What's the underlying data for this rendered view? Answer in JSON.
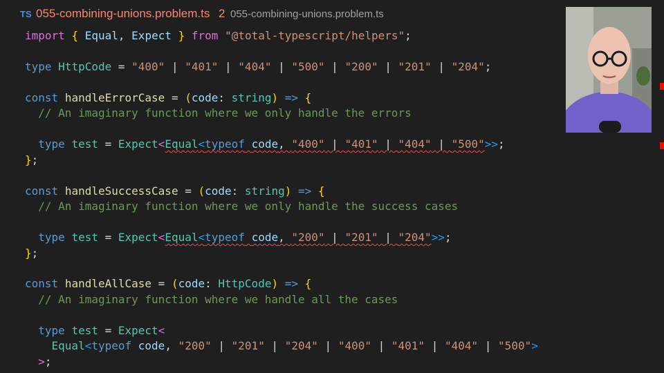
{
  "tab": {
    "lang_badge": "TS",
    "filename": "055-combining-unions.problem.ts",
    "problem_count": "2",
    "description": "055-combining-unions.problem.ts"
  },
  "code": {
    "l1": {
      "kw1": "import",
      "b1": "{",
      "sp1": " ",
      "n1": "Equal",
      "c1": ",",
      "sp2": " ",
      "n2": "Expect",
      "sp3": " ",
      "b2": "}",
      "sp4": " ",
      "kw2": "from",
      "sp5": " ",
      "str": "\"@total-typescript/helpers\"",
      "end": ";"
    },
    "l2": {
      "kw": "type",
      "sp": " ",
      "name": "HttpCode",
      "eq": " = ",
      "v1": "\"400\"",
      "p1": " | ",
      "v2": "\"401\"",
      "p2": " | ",
      "v3": "\"404\"",
      "p3": " | ",
      "v4": "\"500\"",
      "p4": " | ",
      "v5": "\"200\"",
      "p5": " | ",
      "v6": "\"201\"",
      "p6": " | ",
      "v7": "\"204\"",
      "end": ";"
    },
    "l3": {
      "kw": "const",
      "sp": " ",
      "name": "handleErrorCase",
      "eq": " = ",
      "lp": "(",
      "param": "code",
      "colon": ": ",
      "type": "string",
      "rp": ")",
      "arrow": " => ",
      "brace": "{"
    },
    "l4": {
      "comment": "  // An imaginary function where we only handle the errors"
    },
    "l5": {
      "ind": "  ",
      "kw": "type",
      "sp": " ",
      "name": "test",
      "eq": " = ",
      "expect": "Expect",
      "lt1": "<",
      "equal": "Equal",
      "lt2": "<",
      "typeof": "typeof",
      "sp2": " ",
      "code": "code",
      "comma": ", ",
      "v1": "\"400\"",
      "p1": " | ",
      "v2": "\"401\"",
      "p2": " | ",
      "v3": "\"404\"",
      "p3": " | ",
      "v4": "\"500\"",
      "gt": ">>",
      "end": ";"
    },
    "l6": {
      "brace": "}",
      "end": ";"
    },
    "l7": {
      "kw": "const",
      "sp": " ",
      "name": "handleSuccessCase",
      "eq": " = ",
      "lp": "(",
      "param": "code",
      "colon": ": ",
      "type": "string",
      "rp": ")",
      "arrow": " => ",
      "brace": "{"
    },
    "l8": {
      "comment": "  // An imaginary function where we only handle the success cases"
    },
    "l9": {
      "ind": "  ",
      "kw": "type",
      "sp": " ",
      "name": "test",
      "eq": " = ",
      "expect": "Expect",
      "lt1": "<",
      "equal": "Equal",
      "lt2": "<",
      "typeof": "typeof",
      "sp2": " ",
      "code": "code",
      "comma": ", ",
      "v1": "\"200\"",
      "p1": " | ",
      "v2": "\"201\"",
      "p2": " | ",
      "v3": "\"204\"",
      "gt": ">>",
      "end": ";"
    },
    "l10": {
      "brace": "}",
      "end": ";"
    },
    "l11": {
      "kw": "const",
      "sp": " ",
      "name": "handleAllCase",
      "eq": " = ",
      "lp": "(",
      "param": "code",
      "colon": ": ",
      "type": "HttpCode",
      "rp": ")",
      "arrow": " => ",
      "brace": "{"
    },
    "l12": {
      "comment": "  // An imaginary function where we handle all the cases"
    },
    "l13": {
      "ind": "  ",
      "kw": "type",
      "sp": " ",
      "name": "test",
      "eq": " = ",
      "expect": "Expect",
      "lt": "<"
    },
    "l14": {
      "ind": "    ",
      "equal": "Equal",
      "lt": "<",
      "typeof": "typeof",
      "sp": " ",
      "code": "code",
      "comma": ", ",
      "v1": "\"200\"",
      "p1": " | ",
      "v2": "\"201\"",
      "p2": " | ",
      "v3": "\"204\"",
      "p3": " | ",
      "v4": "\"400\"",
      "p4": " | ",
      "v5": "\"401\"",
      "p5": " | ",
      "v6": "\"404\"",
      "p6": " | ",
      "v7": "\"500\"",
      "gt": ">"
    },
    "l15": {
      "ind": "  ",
      "gt": ">",
      "end": ";"
    }
  },
  "colors": {
    "background": "#1f1f1f",
    "keyword": "#569cd6",
    "type": "#4ec9b0",
    "string": "#ce9178",
    "comment": "#6a9955",
    "variable": "#9cdcfe",
    "error": "#f14c4c",
    "tab_error": "#f48771"
  },
  "webcam": {
    "icon": "presenter-video-feed"
  }
}
